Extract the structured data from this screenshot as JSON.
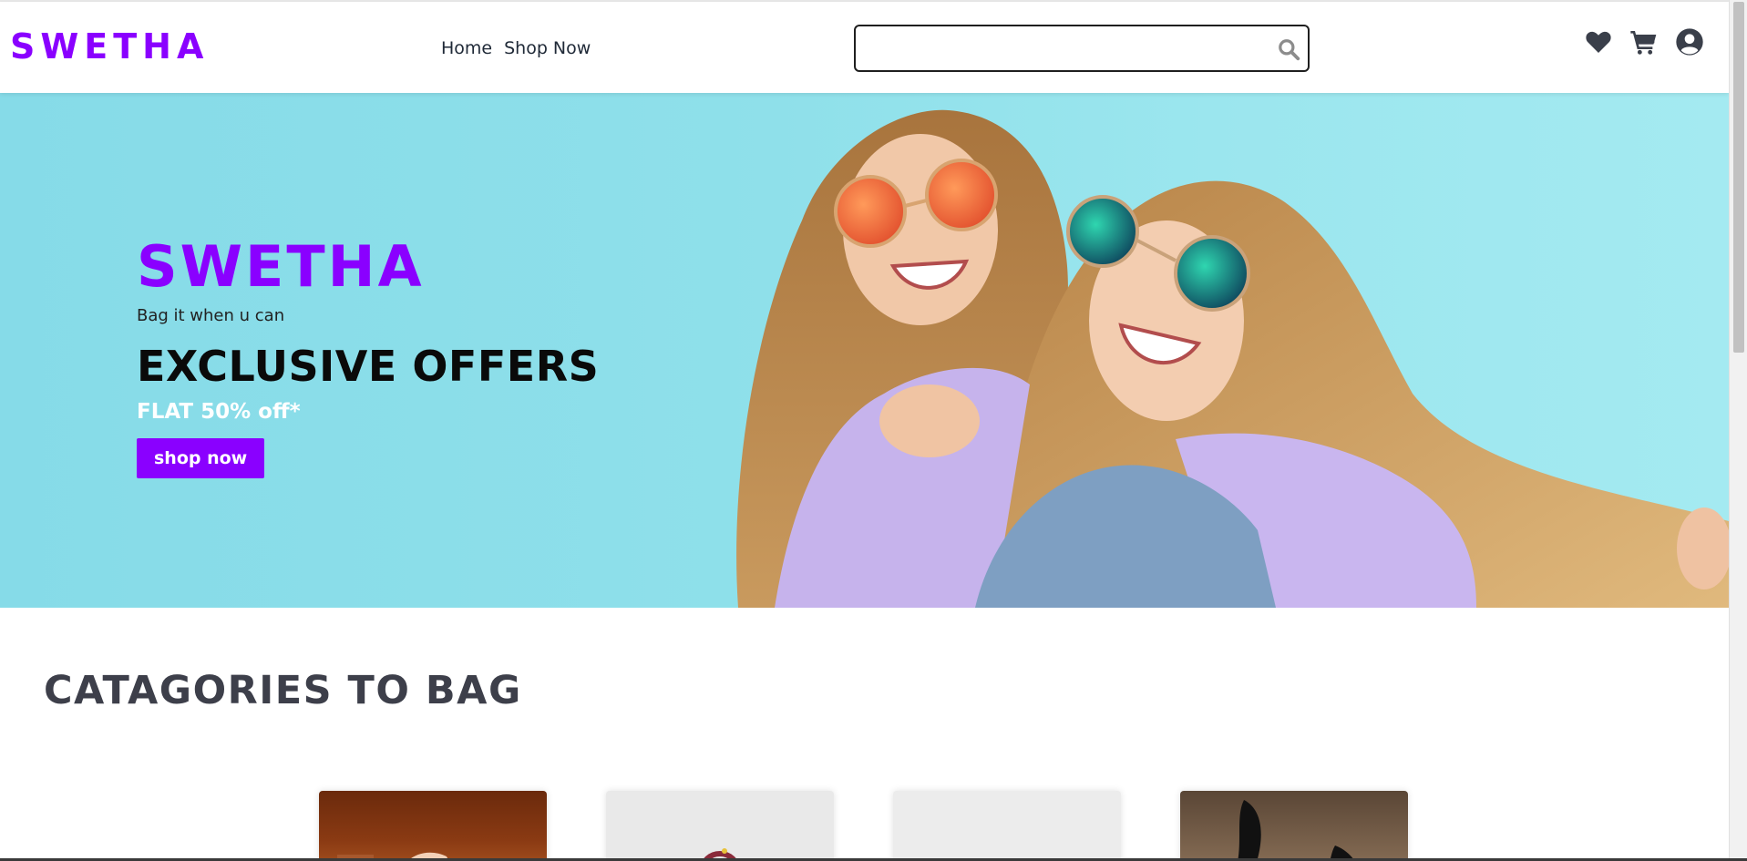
{
  "header": {
    "logo": "SWETHA",
    "nav": [
      {
        "label": "Home"
      },
      {
        "label": "Shop Now"
      }
    ],
    "search": {
      "value": "",
      "placeholder": ""
    },
    "icons": [
      "heart-icon",
      "cart-icon",
      "user-circle-icon"
    ]
  },
  "hero": {
    "brand": "SWETHA",
    "tagline": "Bag it when u can",
    "headline": "EXCLUSIVE OFFERS",
    "offer": "FLAT 50% off*",
    "cta_label": "shop now"
  },
  "categories": {
    "title": "CATAGORIES TO BAG",
    "cards": [
      {
        "name": "category-card-1"
      },
      {
        "name": "category-card-2"
      },
      {
        "name": "category-card-3"
      },
      {
        "name": "category-card-4"
      }
    ]
  },
  "colors": {
    "brand": "#8a00ff",
    "hero_bg": "#8fe0ea",
    "heading": "#3d3f4a"
  }
}
